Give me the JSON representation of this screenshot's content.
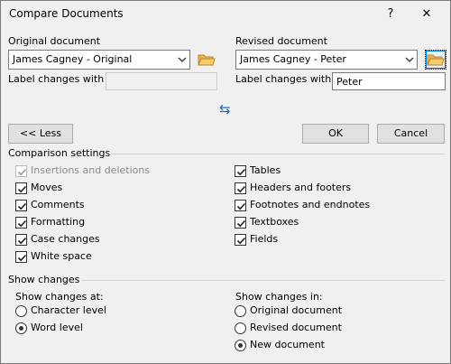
{
  "window": {
    "title": "Compare Documents",
    "help_glyph": "?",
    "close_glyph": "✕"
  },
  "original": {
    "header": "Original document",
    "value": "James Cagney - Original",
    "label_changes_caption": "Label changes with",
    "label_changes_value": ""
  },
  "revised": {
    "header": "Revised document",
    "value": "James Cagney - Peter",
    "label_changes_caption": "Label changes with",
    "label_changes_value": "Peter"
  },
  "swap_glyph": "⇆",
  "buttons": {
    "less": "<< Less",
    "ok": "OK",
    "cancel": "Cancel"
  },
  "comparison": {
    "header": "Comparison settings",
    "left": [
      {
        "label": "Insertions and deletions",
        "checked": true,
        "disabled": true
      },
      {
        "label": "Moves",
        "checked": true,
        "disabled": false
      },
      {
        "label": "Comments",
        "checked": true,
        "disabled": false
      },
      {
        "label": "Formatting",
        "checked": true,
        "disabled": false
      },
      {
        "label": "Case changes",
        "checked": true,
        "disabled": false
      },
      {
        "label": "White space",
        "checked": true,
        "disabled": false
      }
    ],
    "right": [
      {
        "label": "Tables",
        "checked": true,
        "disabled": false
      },
      {
        "label": "Headers and footers",
        "checked": true,
        "disabled": false
      },
      {
        "label": "Footnotes and endnotes",
        "checked": true,
        "disabled": false
      },
      {
        "label": "Textboxes",
        "checked": true,
        "disabled": false
      },
      {
        "label": "Fields",
        "checked": true,
        "disabled": false
      }
    ]
  },
  "show_changes": {
    "header": "Show changes",
    "at_caption": "Show changes at:",
    "at_options": [
      {
        "label": "Character level",
        "selected": false
      },
      {
        "label": "Word level",
        "selected": true
      }
    ],
    "in_caption": "Show changes in:",
    "in_options": [
      {
        "label": "Original document",
        "selected": false
      },
      {
        "label": "Revised document",
        "selected": false
      },
      {
        "label": "New document",
        "selected": true
      }
    ]
  },
  "colors": {
    "accent": "#0078d7",
    "swap_icon": "#1a6fc4",
    "folder": "#e8b54a"
  }
}
